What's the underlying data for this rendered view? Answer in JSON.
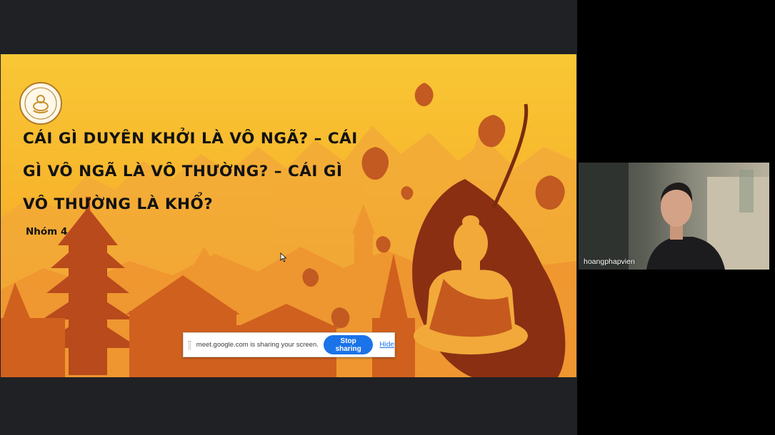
{
  "slide": {
    "title": "CÁI GÌ DUYÊN KHỞI LÀ VÔ NGÃ? – CÁI GÌ VÔ NGÃ LÀ VÔ THƯỜNG? – CÁI GÌ VÔ THƯỜNG LÀ KHỔ?",
    "subtitle": "Nhóm 4"
  },
  "share_bar": {
    "message": "meet.google.com is sharing your screen.",
    "stop_label": "Stop sharing",
    "hide_label": "Hide"
  },
  "participant": {
    "name": "hoangphapvien"
  },
  "colors": {
    "stop_button": "#1a73e8",
    "slide_bg": "#f7b52c"
  }
}
